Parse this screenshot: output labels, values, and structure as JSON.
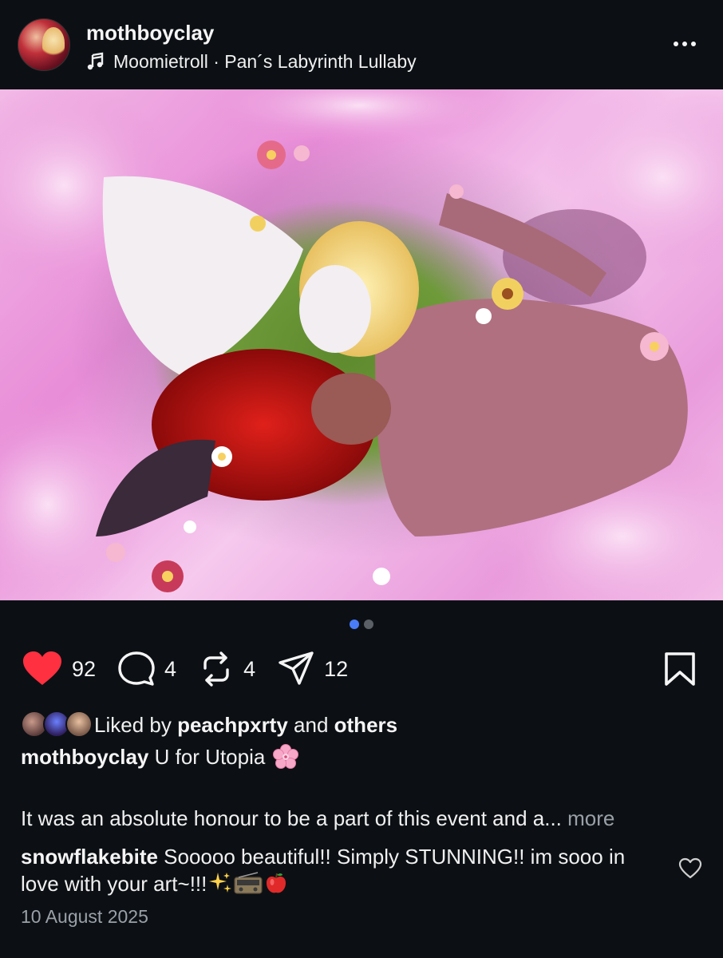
{
  "header": {
    "username": "mothboyclay",
    "music": "Moomietroll · Pan´s Labyrinth Lullaby"
  },
  "carousel": {
    "total": 2,
    "active_index": 0
  },
  "actions": {
    "likes": "92",
    "comments": "4",
    "reposts": "4",
    "shares": "12"
  },
  "liked_by": {
    "prefix": "Liked by ",
    "user": "peachpxrty",
    "middle": " and ",
    "others": "others"
  },
  "caption": {
    "username": "mothboyclay",
    "text": " U for Utopia"
  },
  "body": {
    "text": "It was an absolute honour to be a part of this event and a...",
    "more": "more"
  },
  "comment": {
    "username": "snowflakebite",
    "text": " Sooooo beautiful!! Simply STUNNING!! im sooo in love with your art~!!!"
  },
  "date": "10 August 2025",
  "colors": {
    "background": "#0c1014",
    "like_red": "#ff3040",
    "active_dot": "#4a7bf7",
    "muted_text": "#9aa0a8"
  }
}
